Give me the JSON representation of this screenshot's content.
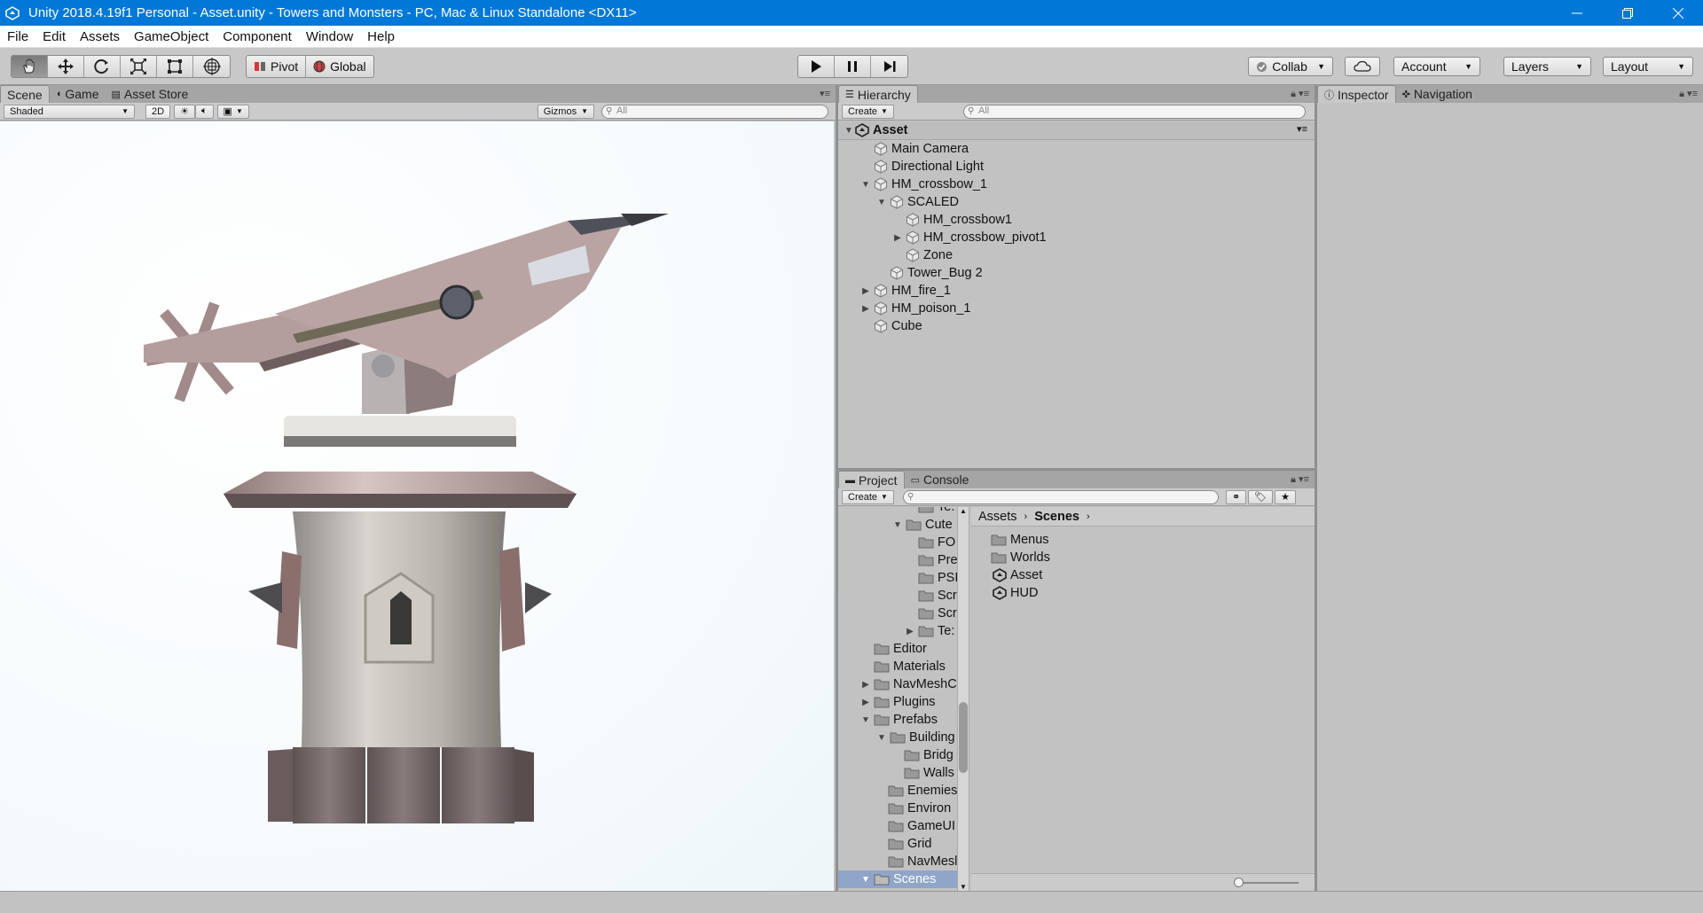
{
  "window": {
    "title": "Unity 2018.4.19f1 Personal - Asset.unity - Towers and Monsters - PC, Mac & Linux Standalone <DX11>"
  },
  "menu": [
    "File",
    "Edit",
    "Assets",
    "GameObject",
    "Component",
    "Window",
    "Help"
  ],
  "toolbar": {
    "pivot": "Pivot",
    "global": "Global",
    "collab": "Collab",
    "account": "Account",
    "layers": "Layers",
    "layout": "Layout"
  },
  "scene_panel": {
    "tabs": [
      "Scene",
      "Game",
      "Asset Store"
    ],
    "shading": "Shaded",
    "mode_2d": "2D",
    "gizmos": "Gizmos",
    "search_placeholder": "All"
  },
  "hierarchy": {
    "tab": "Hierarchy",
    "create": "Create",
    "search_placeholder": "All",
    "scene_name": "Asset",
    "items": [
      {
        "label": "Main Camera"
      },
      {
        "label": "Directional Light"
      },
      {
        "label": "HM_crossbow_1"
      },
      {
        "label": "SCALED"
      },
      {
        "label": "HM_crossbow1"
      },
      {
        "label": "HM_crossbow_pivot1"
      },
      {
        "label": "Zone"
      },
      {
        "label": "Tower_Bug 2"
      },
      {
        "label": "HM_fire_1"
      },
      {
        "label": "HM_poison_1"
      },
      {
        "label": "Cube"
      }
    ]
  },
  "inspector": {
    "tabs": [
      "Inspector",
      "Navigation"
    ]
  },
  "project": {
    "tabs": [
      "Project",
      "Console"
    ],
    "create": "Create",
    "tree": [
      {
        "label": "Te:"
      },
      {
        "label": "Cute"
      },
      {
        "label": "FO"
      },
      {
        "label": "Pre"
      },
      {
        "label": "PSI"
      },
      {
        "label": "Scr"
      },
      {
        "label": "Scr"
      },
      {
        "label": "Te:"
      },
      {
        "label": "Editor"
      },
      {
        "label": "Materials"
      },
      {
        "label": "NavMeshC"
      },
      {
        "label": "Plugins"
      },
      {
        "label": "Prefabs"
      },
      {
        "label": "Building"
      },
      {
        "label": "Bridg"
      },
      {
        "label": "Walls"
      },
      {
        "label": "Enemies"
      },
      {
        "label": "Environ"
      },
      {
        "label": "GameUI"
      },
      {
        "label": "Grid"
      },
      {
        "label": "NavMesl"
      },
      {
        "label": "Scenes"
      }
    ],
    "breadcrumb": [
      "Assets",
      "Scenes"
    ],
    "files": [
      {
        "label": "Menus",
        "icon": "folder-icon"
      },
      {
        "label": "Worlds",
        "icon": "folder-icon"
      },
      {
        "label": "Asset",
        "icon": "unity-scene-icon"
      },
      {
        "label": "HUD",
        "icon": "unity-scene-icon"
      }
    ]
  }
}
